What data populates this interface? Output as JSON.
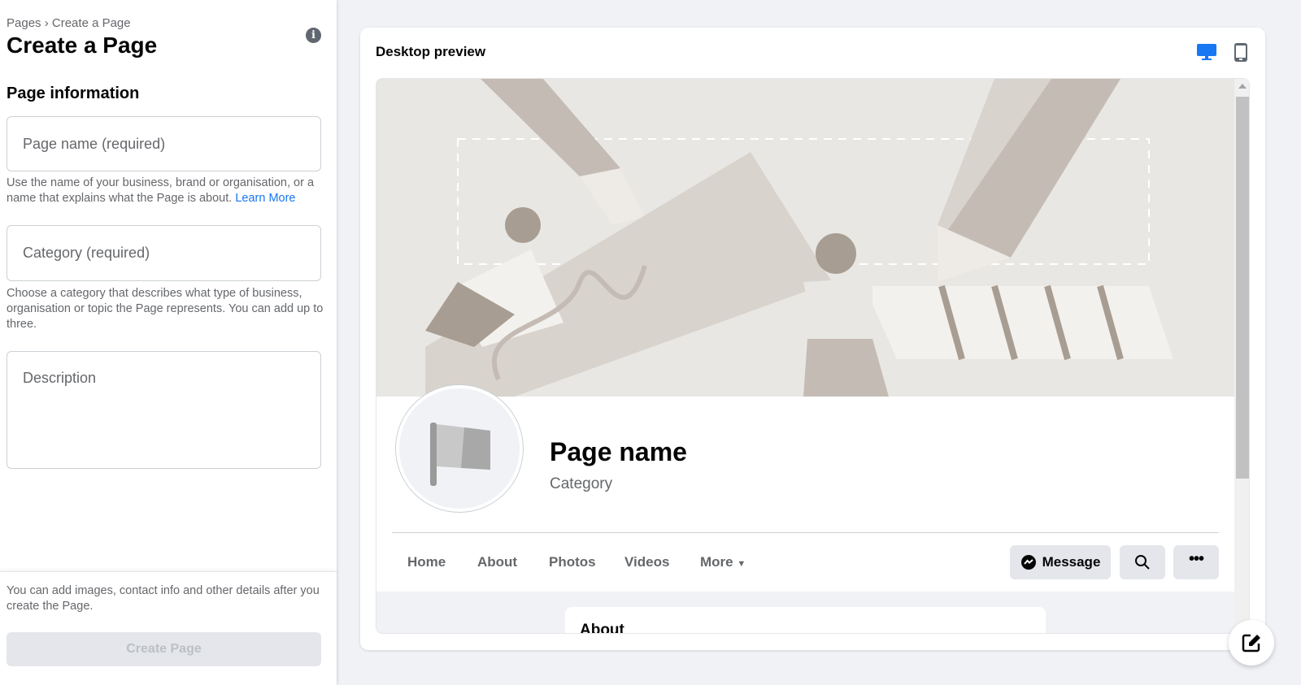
{
  "left": {
    "breadcrumb": [
      "Pages",
      "›",
      "Create a Page"
    ],
    "title": "Create a Page",
    "section": "Page information",
    "name_placeholder": "Page name (required)",
    "name_help": "Use the name of your business, brand or organisation, or a name that explains what the Page is about.",
    "learn_more": "Learn More",
    "category_placeholder": "Category (required)",
    "category_help": "Choose a category that describes what type of business, organisation or topic the Page represents. You can add up to three.",
    "description_placeholder": "Description",
    "footer_note": "You can add images, contact info and other details after you create the Page.",
    "create_button": "Create Page"
  },
  "preview": {
    "title": "Desktop preview",
    "page_name": "Page name",
    "category": "Category",
    "tabs": [
      "Home",
      "About",
      "Photos",
      "Videos",
      "More"
    ],
    "message_button": "Message",
    "about_heading": "About"
  },
  "colors": {
    "accent": "#1877f2",
    "disabled_text": "#bcc0c4"
  }
}
